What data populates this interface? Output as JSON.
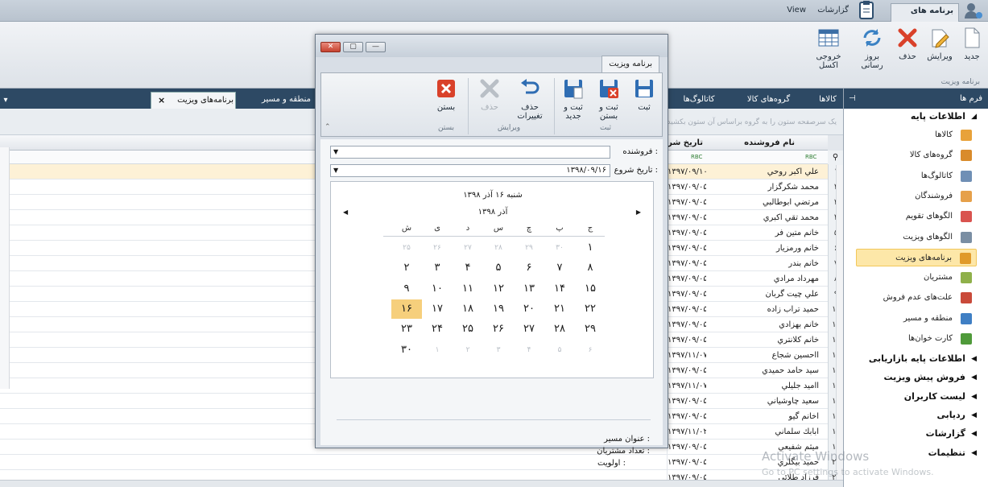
{
  "titlebar": {
    "tabs": [
      {
        "label": "برنامه های ویزیت",
        "active": true
      },
      {
        "label": "گزارشات",
        "active": false
      },
      {
        "label": "View",
        "active": false
      }
    ]
  },
  "ribbon": {
    "buttons": [
      {
        "label": "جدید",
        "icon": "new-document-icon"
      },
      {
        "label": "ویرایش",
        "icon": "pencil-icon"
      },
      {
        "label": "حذف",
        "icon": "delete-x-icon"
      },
      {
        "label": "بروز رسانی",
        "icon": "refresh-icon"
      },
      {
        "label": "خروجی اکسل",
        "icon": "excel-grid-icon"
      }
    ],
    "group_label": "برنامه ویزیت"
  },
  "doc_tabs": [
    {
      "label": "برنامه‌های ویزیت",
      "active": true
    },
    {
      "label": "منطقه و مسیر",
      "active": false
    },
    {
      "label": "کاتالوگ‌ها",
      "active": false
    },
    {
      "label": "گروه‌های کالا",
      "active": false
    },
    {
      "label": "کالاها",
      "active": false
    }
  ],
  "grid": {
    "group_hint": "یک سرصفحه ستون را به گروه براساس آن ستون بکشید",
    "columns": {
      "name": "نام فروشنده",
      "date": "تاریخ شر"
    },
    "filter_glyph": "RBC",
    "rows": [
      {
        "n": "۱",
        "name": "علي اكبر روحي",
        "date": "۱۳۹۷/۰۹/۱۰"
      },
      {
        "n": "۲",
        "name": "محمد شكرگزار",
        "date": "۱۳۹۷/۰۹/۰۵"
      },
      {
        "n": "۳",
        "name": "مرتضي ابوطالبي",
        "date": "۱۳۹۷/۰۹/۰۵"
      },
      {
        "n": "۴",
        "name": "محمد تقي اكبري",
        "date": "۱۳۹۷/۰۹/۰۵"
      },
      {
        "n": "۵",
        "name": "خانم متين فر",
        "date": "۱۳۹۷/۰۹/۰۵"
      },
      {
        "n": "۶",
        "name": "خانم ورمزيار",
        "date": "۱۳۹۷/۰۹/۰۵"
      },
      {
        "n": "۷",
        "name": "خانم بندر",
        "date": "۱۳۹۷/۰۹/۰۵"
      },
      {
        "n": "۸",
        "name": "مهرداد مرادي",
        "date": "۱۳۹۷/۰۹/۰۵"
      },
      {
        "n": "۹",
        "name": "علي چيت گربان",
        "date": "۱۳۹۷/۰۹/۰۵"
      },
      {
        "n": "۱۰",
        "name": "حميد تراب زاده",
        "date": "۱۳۹۷/۰۹/۰۵"
      },
      {
        "n": "۱۱",
        "name": "خانم بهزادي",
        "date": "۱۳۹۷/۰۹/۰۵"
      },
      {
        "n": "۱۲",
        "name": "خانم كلانتري",
        "date": "۱۳۹۷/۰۹/۰۵"
      },
      {
        "n": "۱۳",
        "name": "ااحسين شجاع",
        "date": "۱۳۹۷/۱۱/۰۷"
      },
      {
        "n": "۱۴",
        "name": "سيد حامد حميدي",
        "date": "۱۳۹۷/۰۹/۰۵"
      },
      {
        "n": "۱۵",
        "name": "ااميد جليلي",
        "date": "۱۳۹۷/۱۱/۰۷"
      },
      {
        "n": "۱۶",
        "name": "سعيد چاوشياني",
        "date": "۱۳۹۷/۰۹/۰۵"
      },
      {
        "n": "۱۷",
        "name": "اخانم گيو",
        "date": "۱۳۹۷/۰۹/۰۵"
      },
      {
        "n": "۱۸",
        "name": "ابابك سلماني",
        "date": "۱۳۹۷/۱۱/۰۲"
      },
      {
        "n": "۱۹",
        "name": "ميثم شفيعي",
        "date": "۱۳۹۷/۰۹/۰۵"
      },
      {
        "n": "۲۰",
        "name": "حميد بيگلري",
        "date": "۱۳۹۷/۰۹/۰۵"
      },
      {
        "n": "۲۱",
        "name": "فرزاد طلائي",
        "date": "۱۳۹۷/۰۹/۰۵"
      }
    ]
  },
  "sidebar": {
    "title": "فرم ها",
    "base_info": "اطلاعات پایه",
    "items": [
      {
        "label": "کالاها",
        "icon": "box-icon",
        "color": "#e8a23a"
      },
      {
        "label": "گروه‌های کالا",
        "icon": "boxes-icon",
        "color": "#d98b2b"
      },
      {
        "label": "کاتالوگ‌ها",
        "icon": "picture-icon",
        "color": "#6f8fb5"
      },
      {
        "label": "فروشندگان",
        "icon": "person-icon",
        "color": "#e6a04a"
      },
      {
        "label": "الگوهای تقویم",
        "icon": "calendar-icon",
        "color": "#d9534f"
      },
      {
        "label": "الگوهای ویزیت",
        "icon": "list-icon",
        "color": "#7a8ea3"
      },
      {
        "label": "برنامه‌های ویزیت",
        "icon": "clock-icon",
        "color": "#e09a2a"
      },
      {
        "label": "مشتریان",
        "icon": "customer-icon",
        "color": "#8fb04a"
      },
      {
        "label": "علت‌های عدم فروش",
        "icon": "cancel-icon",
        "color": "#c94a3a"
      },
      {
        "label": "منطقه و مسیر",
        "icon": "map-pin-icon",
        "color": "#3f7fc4"
      },
      {
        "label": "کارت خوان‌ها",
        "icon": "card-reader-icon",
        "color": "#4f9a3a"
      }
    ],
    "sections": [
      "اطلاعات پایه بازاریابی",
      "فروش پیش ویزیت",
      "لیست کاربران",
      "ردیابی",
      "گزارشات",
      "تنظیمات"
    ]
  },
  "dialog": {
    "tab": "برنامه ویزیت",
    "buttons": [
      {
        "label": "ثبت",
        "icon": "save-icon",
        "enabled": true
      },
      {
        "label": "ثبت و بستن",
        "icon": "save-close-icon",
        "enabled": true
      },
      {
        "label": "ثبت و جدید",
        "icon": "save-new-icon",
        "enabled": true
      },
      {
        "label": "حذف تغییرات",
        "icon": "undo-icon",
        "enabled": true
      },
      {
        "label": "حذف",
        "icon": "delete-icon",
        "enabled": false
      },
      {
        "label": "بستن",
        "icon": "close-icon",
        "enabled": true
      }
    ],
    "groups": [
      "ثبت",
      "ویرایش",
      "بستن"
    ],
    "seller_label": "فروشنده :",
    "seller_value": "",
    "start_label": "تاریخ شروع :",
    "start_value": "۱۳۹۸/۰۹/۱۶",
    "calendar": {
      "full_date": "شنبه ۱۶ آذر ۱۳۹۸",
      "month": "آذر ۱۳۹۸",
      "weekdays": [
        "ج",
        "پ",
        "چ",
        "س",
        "د",
        "ی",
        "ش"
      ],
      "weeks": [
        [
          {
            "d": "۱"
          },
          {
            "d": "۳۰",
            "o": true
          },
          {
            "d": "۲۹",
            "o": true
          },
          {
            "d": "۲۸",
            "o": true
          },
          {
            "d": "۲۷",
            "o": true
          },
          {
            "d": "۲۶",
            "o": true
          },
          {
            "d": "۲۵",
            "o": true
          }
        ],
        [
          {
            "d": "۸"
          },
          {
            "d": "۷"
          },
          {
            "d": "۶"
          },
          {
            "d": "۵"
          },
          {
            "d": "۴"
          },
          {
            "d": "۳"
          },
          {
            "d": "۲"
          }
        ],
        [
          {
            "d": "۱۵"
          },
          {
            "d": "۱۴"
          },
          {
            "d": "۱۳"
          },
          {
            "d": "۱۲"
          },
          {
            "d": "۱۱"
          },
          {
            "d": "۱۰"
          },
          {
            "d": "۹"
          }
        ],
        [
          {
            "d": "۲۲"
          },
          {
            "d": "۲۱"
          },
          {
            "d": "۲۰"
          },
          {
            "d": "۱۹"
          },
          {
            "d": "۱۸"
          },
          {
            "d": "۱۷"
          },
          {
            "d": "۱۶",
            "today": true
          }
        ],
        [
          {
            "d": "۲۹"
          },
          {
            "d": "۲۸"
          },
          {
            "d": "۲۷"
          },
          {
            "d": "۲۶"
          },
          {
            "d": "۲۵"
          },
          {
            "d": "۲۴"
          },
          {
            "d": "۲۳"
          }
        ],
        [
          {
            "d": "۶",
            "o": true
          },
          {
            "d": "۵",
            "o": true
          },
          {
            "d": "۴",
            "o": true
          },
          {
            "d": "۳",
            "o": true
          },
          {
            "d": "۲",
            "o": true
          },
          {
            "d": "۱",
            "o": true
          },
          {
            "d": "۳۰"
          }
        ]
      ]
    },
    "route_label": "عنوان مسیر :",
    "customers_label": "تعداد مشتریان :",
    "priority_label": "اولویت :"
  },
  "watermark": {
    "line1": "Activate Windows",
    "line2": "Go to PC settings to activate Windows."
  }
}
